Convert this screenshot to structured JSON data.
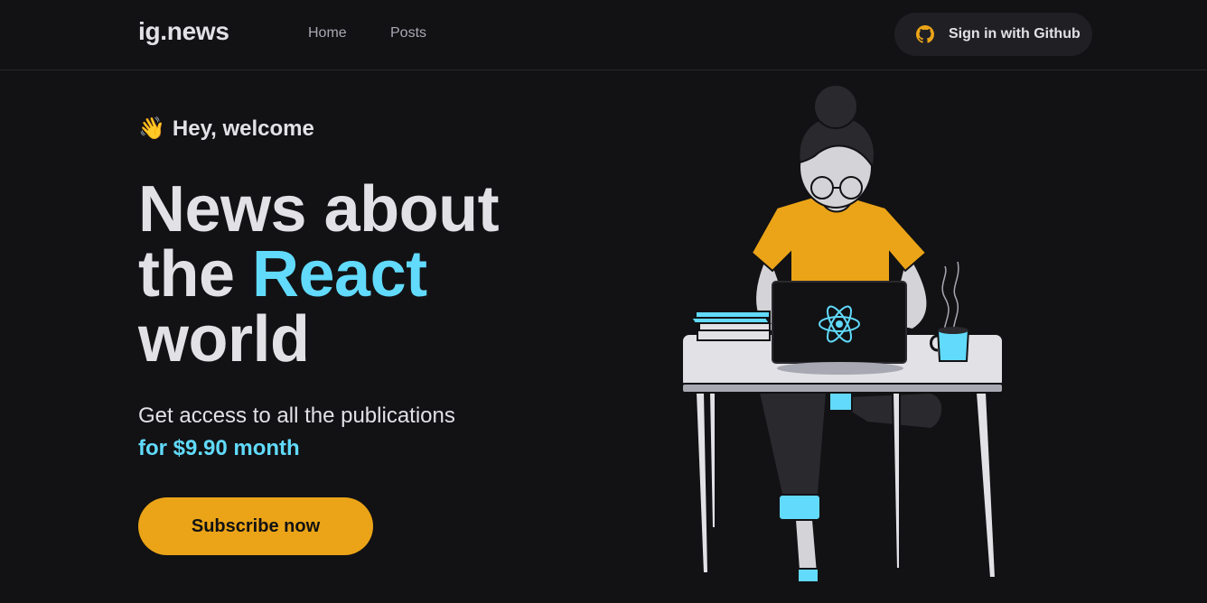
{
  "header": {
    "logo": "ig.news",
    "nav": [
      {
        "label": "Home"
      },
      {
        "label": "Posts"
      }
    ],
    "signin_label": "Sign in with Github"
  },
  "hero": {
    "welcome_emoji": "👋",
    "welcome": "Hey, welcome",
    "title_line1": "News about",
    "title_line2_prefix": "the",
    "title_accent": "React",
    "title_line3": "world",
    "subtitle": "Get access to all the publications",
    "price": "for $9.90 month",
    "cta_label": "Subscribe now"
  },
  "colors": {
    "background": "#121214",
    "accent_cyan": "#61dafb",
    "accent_yellow": "#eba417",
    "text": "#e1e1e6",
    "muted": "#a8a8b3"
  },
  "icons": {
    "signin": "github-icon",
    "laptop": "react-logo-icon"
  }
}
